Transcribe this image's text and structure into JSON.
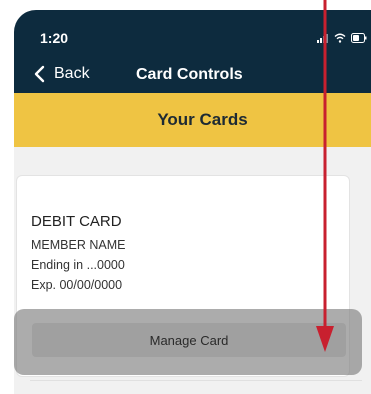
{
  "status_bar": {
    "time": "1:20"
  },
  "nav": {
    "back_label": "Back",
    "title": "Card Controls"
  },
  "section": {
    "title": "Your Cards"
  },
  "card": {
    "type": "DEBIT CARD",
    "member_name": "MEMBER NAME",
    "ending": "Ending in ...0000",
    "expiration": "Exp. 00/00/0000",
    "manage_label": "Manage Card"
  },
  "colors": {
    "header_bg": "#0d2b3e",
    "band_bg": "#efc443",
    "annotation_arrow": "#c8202f"
  },
  "icons": [
    "signal-icon",
    "wifi-icon",
    "battery-icon",
    "chevron-left-icon",
    "annotation-arrow"
  ]
}
